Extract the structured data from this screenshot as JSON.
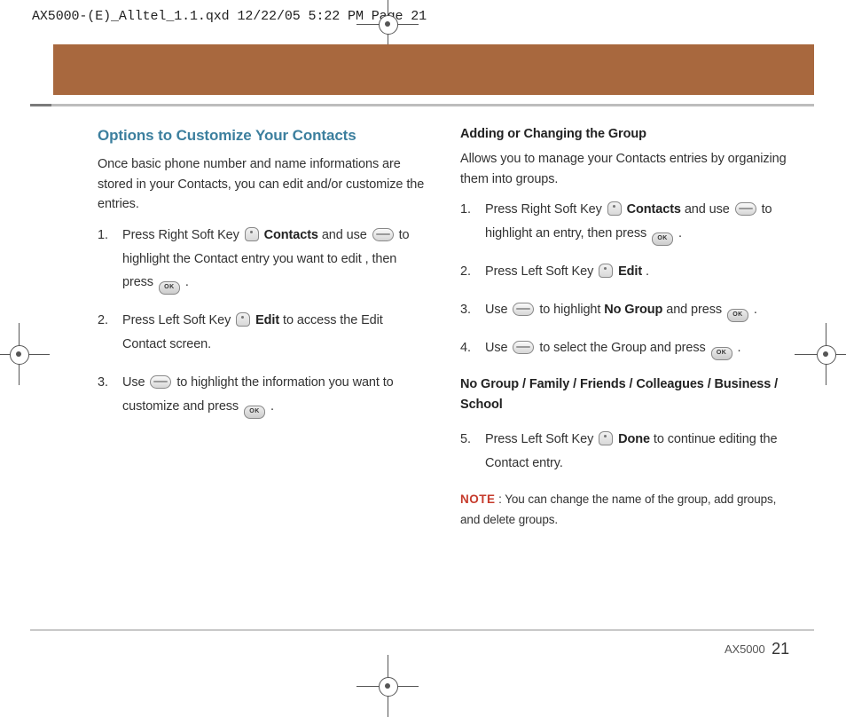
{
  "slug": "AX5000-(E)_Alltel_1.1.qxd  12/22/05  5:22 PM  Page 21",
  "left": {
    "heading": "Options to Customize Your Contacts",
    "intro": "Once basic phone number and name informations are stored in your Contacts, you can edit and/or customize the entries.",
    "steps": {
      "s1a": "Press Right Soft Key ",
      "s1b": " Contacts",
      "s1c": " and use ",
      "s1d": " to highlight the Contact entry you want to edit , then press ",
      "s1e": ".",
      "s2a": "Press Left Soft Key ",
      "s2b": " Edit",
      "s2c": " to access the Edit Contact screen.",
      "s3a": "Use ",
      "s3b": " to highlight the information you want to customize and press ",
      "s3c": "."
    }
  },
  "right": {
    "heading": "Adding or Changing the Group",
    "intro": "Allows you to manage your Contacts entries by organizing them into groups.",
    "steps": {
      "s1a": "Press Right Soft Key ",
      "s1b": " Contacts",
      "s1c": " and use ",
      "s1d": " to highlight an entry, then press ",
      "s1e": ".",
      "s2a": "Press Left Soft Key ",
      "s2b": " Edit",
      "s2c": ".",
      "s3a": "Use ",
      "s3b": " to highlight ",
      "s3c": "No Group",
      "s3d": " and press ",
      "s3e": ".",
      "s4a": "Use ",
      "s4b": " to select the Group and press ",
      "s4c": "."
    },
    "groups": "No Group / Family / Friends / Colleagues / Business / School",
    "step5a": "Press Left Soft Key ",
    "step5b": " Done",
    "step5c": " to continue editing the Contact entry.",
    "note_label": "NOTE",
    "note_text": " : You can change the name of the group, add groups, and delete groups."
  },
  "footer": {
    "model": "AX5000",
    "page": "21"
  },
  "ok_label": "OK"
}
